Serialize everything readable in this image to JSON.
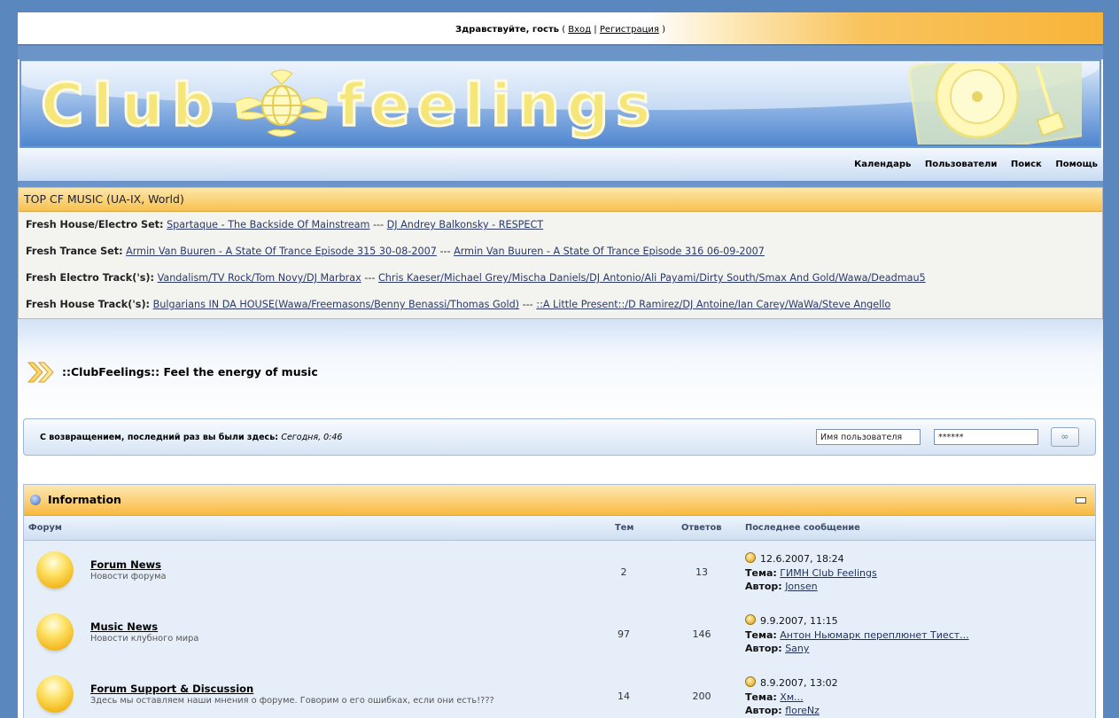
{
  "welcome": {
    "greeting": "Здравствуйте, гость",
    "open": "(",
    "login": "Вход",
    "sep": "|",
    "register": "Регистрация",
    "close": ")"
  },
  "banner": {
    "logo": "CLUB FEELINGS"
  },
  "nav": {
    "items": [
      "Календарь",
      "Пользователи",
      "Поиск",
      "Помощь"
    ]
  },
  "top_music": {
    "title": "TOP CF MUSIC (UA-IX, World)",
    "rows": [
      {
        "label": "Fresh House/Electro Set:",
        "link1": "Spartaque - The Backside Of Mainstream",
        "sep": "---",
        "link2": "DJ Andrey Balkonsky - RESPECT"
      },
      {
        "label": "Fresh Trance Set:",
        "link1": "Armin Van Buuren - A State Of Trance Episode 315 30-08-2007",
        "sep": "---",
        "link2": "Armin Van Buuren - A State Of Trance Episode 316 06-09-2007"
      },
      {
        "label": "Fresh Electro Track('s):",
        "link1": "Vandalism/TV Rock/Tom Novy/DJ Marbrax",
        "sep": "---",
        "link2": "Chris Kaeser/Michael Grey/Mischa Daniels/DJ Antonio/Ali Payami/Dirty South/Smax And Gold/Wawa/Deadmau5"
      },
      {
        "label": "Fresh House Track('s):",
        "link1": "Bulgarians IN DA HOUSE(Wawa/Freemasons/Benny Benassi/Thomas Gold)",
        "sep": "---",
        "link2": "::A Little Present::/D Ramirez/DJ Antoine/Ian Carey/WaWa/Steve Angello"
      }
    ]
  },
  "tagline": "::ClubFeelings:: Feel the energy of music",
  "login_bar": {
    "message": "С возвращением, последний раз вы были здесь:",
    "last_visit": "Сегодня, 0:46",
    "username_value": "Имя пользователя",
    "password_value": "******"
  },
  "category": {
    "title": "Information",
    "columns": {
      "forum": "Форум",
      "topics": "Тем",
      "replies": "Ответов",
      "last": "Последнее сообщение"
    },
    "topic_label": "Тема:",
    "author_label": "Автор:",
    "forums": [
      {
        "name": "Forum News",
        "desc": "Новости форума",
        "topics": "2",
        "replies": "13",
        "date": "12.6.2007, 18:24",
        "topic": "ГИМН Club Feelings",
        "author": "Jonsen"
      },
      {
        "name": "Music News",
        "desc": "Новости клубного мира",
        "topics": "97",
        "replies": "146",
        "date": "9.9.2007, 11:15",
        "topic": "Антон Ньюмарк переплюнет Тиест...",
        "author": "Sany"
      },
      {
        "name": "Forum Support & Discussion",
        "desc": "Здесь мы оставляем наши мнения о форуме. Говорим о его ошибках, если они есть!???",
        "topics": "14",
        "replies": "200",
        "date": "8.9.2007, 13:02",
        "topic": "Хм...",
        "author": "floreNz"
      }
    ]
  }
}
